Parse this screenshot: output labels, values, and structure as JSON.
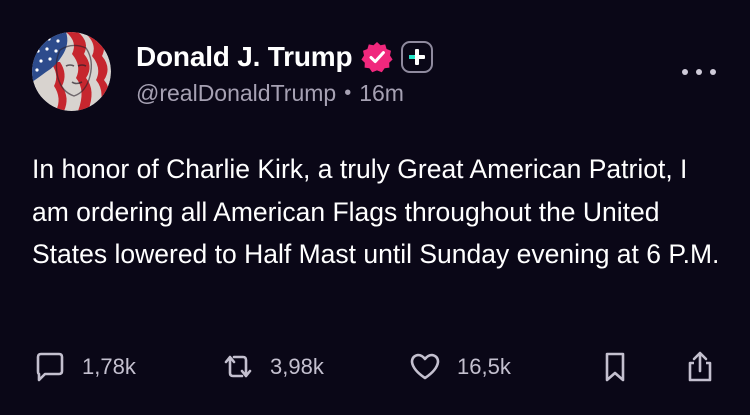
{
  "post": {
    "author": {
      "display_name": "Donald J. Trump",
      "handle": "@realDonaldTrump",
      "separator": "•",
      "time_ago": "16m",
      "avatar_icon": "flag-portrait-avatar",
      "verified_icon": "verified-badge-icon",
      "badge_icon": "plus-badge-icon"
    },
    "text": "In honor of Charlie Kirk, a truly Great American Patriot, I am ordering all American Flags throughout the United States lowered to Half Mast until Sunday evening at 6 P.M.",
    "actions": {
      "replies": "1,78k",
      "reposts": "3,98k",
      "likes": "16,5k"
    }
  },
  "colors": {
    "background": "#0a0717",
    "verified": "#f0287d",
    "plus_accent": "#22e6c8",
    "secondary_text": "#a6a1b3"
  }
}
